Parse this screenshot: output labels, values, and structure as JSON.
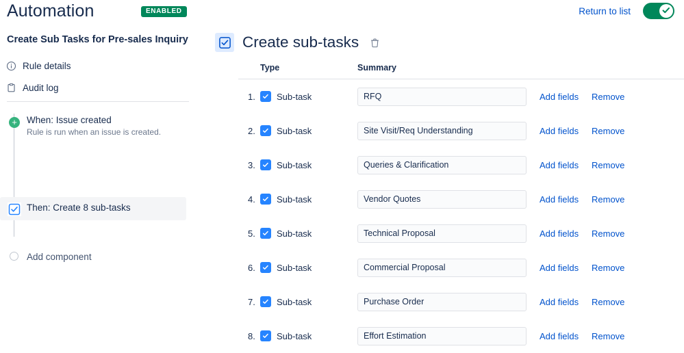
{
  "header": {
    "title": "Automation",
    "badge": "ENABLED",
    "return_link": "Return to list",
    "toggle_state": "on",
    "toggle_color": "#00875a",
    "badge_color": "#00875a",
    "link_color": "#0052cc"
  },
  "sidebar": {
    "rule_name": "Create Sub Tasks for Pre-sales Inquiry",
    "nav": [
      {
        "label": "Rule details",
        "icon": "info-circle-icon"
      },
      {
        "label": "Audit log",
        "icon": "clipboard-icon"
      }
    ],
    "components": [
      {
        "kind": "when",
        "title": "When: Issue created",
        "subtitle": "Rule is run when an issue is created.",
        "icon": "plus-circle-icon"
      },
      {
        "kind": "then",
        "title": "Then: Create 8 sub-tasks",
        "subtitle": "",
        "icon": "subtask-icon",
        "selected": true
      }
    ],
    "add_component": "Add component"
  },
  "main": {
    "icon": "subtask-icon",
    "title": "Create sub-tasks",
    "delete_icon": "trash-icon",
    "columns": [
      "",
      "Type",
      "Summary",
      "",
      ""
    ],
    "column_labels": {
      "type": "Type",
      "summary": "Summary"
    },
    "row_actions": {
      "add_fields": "Add fields",
      "remove": "Remove"
    },
    "rows": [
      {
        "num": "1.",
        "type": "Sub-task",
        "summary": "RFQ",
        "add_fields": "Add fields",
        "remove": "Remove"
      },
      {
        "num": "2.",
        "type": "Sub-task",
        "summary": "Site Visit/Req Understanding",
        "add_fields": "Add fields",
        "remove": "Remove"
      },
      {
        "num": "3.",
        "type": "Sub-task",
        "summary": "Queries & Clarification",
        "add_fields": "Add fields",
        "remove": "Remove"
      },
      {
        "num": "4.",
        "type": "Sub-task",
        "summary": "Vendor Quotes",
        "add_fields": "Add fields",
        "remove": "Remove"
      },
      {
        "num": "5.",
        "type": "Sub-task",
        "summary": "Technical Proposal",
        "add_fields": "Add fields",
        "remove": "Remove"
      },
      {
        "num": "6.",
        "type": "Sub-task",
        "summary": "Commercial Proposal",
        "add_fields": "Add fields",
        "remove": "Remove"
      },
      {
        "num": "7.",
        "type": "Sub-task",
        "summary": "Purchase Order",
        "add_fields": "Add fields",
        "remove": "Remove"
      },
      {
        "num": "8.",
        "type": "Sub-task",
        "summary": "Effort Estimation",
        "add_fields": "Add fields",
        "remove": "Remove"
      }
    ]
  }
}
